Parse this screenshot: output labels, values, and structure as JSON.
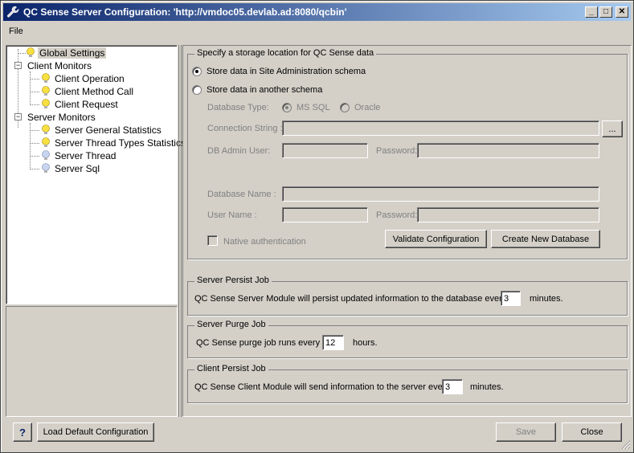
{
  "window": {
    "title": "QC Sense Server Configuration: 'http://vmdoc05.devlab.ad:8080/qcbin'"
  },
  "menu": {
    "file": "File"
  },
  "tree": {
    "global_settings": "Global Settings",
    "client_monitors": "Client Monitors",
    "client_operation": "Client Operation",
    "client_method_call": "Client Method Call",
    "client_request": "Client Request",
    "server_monitors": "Server Monitors",
    "server_general_statistics": "Server General Statistics",
    "server_thread_types_statistics": "Server Thread Types Statistics",
    "server_thread": "Server Thread",
    "server_sql": "Server Sql"
  },
  "storage": {
    "group_title": "Specify a storage location for QC Sense data",
    "radio_site_admin": "Store data in Site Administration schema",
    "radio_another_schema": "Store data in another schema",
    "db_type_label": "Database Type:",
    "db_type_mssql": "MS SQL",
    "db_type_oracle": "Oracle",
    "connection_string_label": "Connection String :",
    "browse_button": "...",
    "db_admin_user_label": "DB Admin User:",
    "password_label": "Password:",
    "database_name_label": "Database Name :",
    "user_name_label": "User Name :",
    "password2_label": "Password:",
    "native_auth_label": "Native authentication",
    "validate_button": "Validate Configuration",
    "create_db_button": "Create New Database"
  },
  "server_persist": {
    "group_title": "Server Persist Job",
    "text_before": "QC Sense Server Module will persist updated information to the database every",
    "value": "3",
    "text_after": "minutes."
  },
  "server_purge": {
    "group_title": "Server Purge Job",
    "text_before": "QC Sense purge job runs every",
    "value": "12",
    "text_after": "hours."
  },
  "client_persist": {
    "group_title": "Client Persist Job",
    "text_before": "QC Sense Client Module will send information to the server every",
    "value": "3",
    "text_after": "minutes."
  },
  "footer": {
    "help_button": "?",
    "load_default_button": "Load Default Configuration",
    "save_button": "Save",
    "close_button": "Close"
  },
  "colors": {
    "title_gradient_start": "#0a246a",
    "title_gradient_end": "#a6caf0",
    "bulb_yellow": "#f8e040",
    "bulb_blue": "#c8d4f0"
  }
}
